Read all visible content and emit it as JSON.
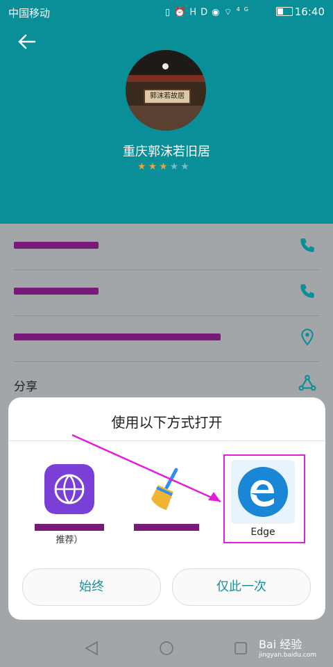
{
  "status_bar": {
    "carrier": "中国移动",
    "icons": "▯⏰HD◉⌔",
    "signal": "4G",
    "time": "16:40"
  },
  "header": {
    "title": "重庆郭沫若旧居",
    "stars_filled": 3,
    "stars_total": 5,
    "plaque_text": "郭沫若故居"
  },
  "list": {
    "rows": [
      {
        "text": "",
        "icon": "phone-icon"
      },
      {
        "text": "",
        "icon": "phone-icon"
      },
      {
        "text": "",
        "icon": "location-icon"
      },
      {
        "text": "分享",
        "icon": "share-icon"
      }
    ]
  },
  "dialog": {
    "title": "使用以下方式打开",
    "apps": [
      {
        "label": "推荐）",
        "icon": "browser-globe-icon"
      },
      {
        "label": "",
        "icon": "broom-cleaner-icon"
      },
      {
        "label": "Edge",
        "icon": "edge-icon"
      }
    ],
    "buttons": {
      "always": "始终",
      "once": "仅此一次"
    }
  },
  "watermark": {
    "text": "Bai 经验",
    "url": "jingyan.baidu.com"
  },
  "colors": {
    "teal": "#0a8f98",
    "annotation": "#e020d8",
    "redaction": "#7a1a78"
  }
}
